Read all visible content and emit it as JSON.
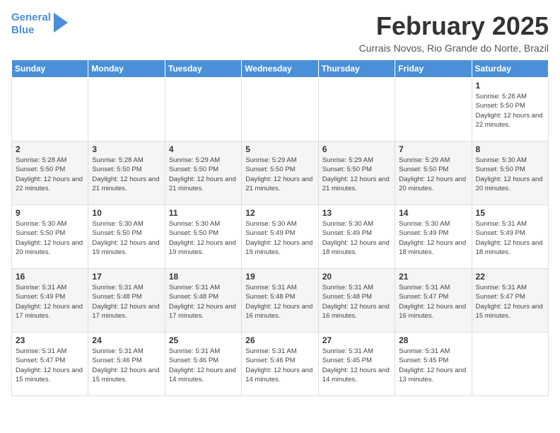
{
  "logo": {
    "line1": "General",
    "line2": "Blue"
  },
  "title": "February 2025",
  "location": "Currais Novos, Rio Grande do Norte, Brazil",
  "days_of_week": [
    "Sunday",
    "Monday",
    "Tuesday",
    "Wednesday",
    "Thursday",
    "Friday",
    "Saturday"
  ],
  "weeks": [
    [
      {
        "day": "",
        "info": ""
      },
      {
        "day": "",
        "info": ""
      },
      {
        "day": "",
        "info": ""
      },
      {
        "day": "",
        "info": ""
      },
      {
        "day": "",
        "info": ""
      },
      {
        "day": "",
        "info": ""
      },
      {
        "day": "1",
        "info": "Sunrise: 5:28 AM\nSunset: 5:50 PM\nDaylight: 12 hours and 22 minutes."
      }
    ],
    [
      {
        "day": "2",
        "info": "Sunrise: 5:28 AM\nSunset: 5:50 PM\nDaylight: 12 hours and 22 minutes."
      },
      {
        "day": "3",
        "info": "Sunrise: 5:28 AM\nSunset: 5:50 PM\nDaylight: 12 hours and 21 minutes."
      },
      {
        "day": "4",
        "info": "Sunrise: 5:29 AM\nSunset: 5:50 PM\nDaylight: 12 hours and 21 minutes."
      },
      {
        "day": "5",
        "info": "Sunrise: 5:29 AM\nSunset: 5:50 PM\nDaylight: 12 hours and 21 minutes."
      },
      {
        "day": "6",
        "info": "Sunrise: 5:29 AM\nSunset: 5:50 PM\nDaylight: 12 hours and 21 minutes."
      },
      {
        "day": "7",
        "info": "Sunrise: 5:29 AM\nSunset: 5:50 PM\nDaylight: 12 hours and 20 minutes."
      },
      {
        "day": "8",
        "info": "Sunrise: 5:30 AM\nSunset: 5:50 PM\nDaylight: 12 hours and 20 minutes."
      }
    ],
    [
      {
        "day": "9",
        "info": "Sunrise: 5:30 AM\nSunset: 5:50 PM\nDaylight: 12 hours and 20 minutes."
      },
      {
        "day": "10",
        "info": "Sunrise: 5:30 AM\nSunset: 5:50 PM\nDaylight: 12 hours and 19 minutes."
      },
      {
        "day": "11",
        "info": "Sunrise: 5:30 AM\nSunset: 5:50 PM\nDaylight: 12 hours and 19 minutes."
      },
      {
        "day": "12",
        "info": "Sunrise: 5:30 AM\nSunset: 5:49 PM\nDaylight: 12 hours and 19 minutes."
      },
      {
        "day": "13",
        "info": "Sunrise: 5:30 AM\nSunset: 5:49 PM\nDaylight: 12 hours and 18 minutes."
      },
      {
        "day": "14",
        "info": "Sunrise: 5:30 AM\nSunset: 5:49 PM\nDaylight: 12 hours and 18 minutes."
      },
      {
        "day": "15",
        "info": "Sunrise: 5:31 AM\nSunset: 5:49 PM\nDaylight: 12 hours and 18 minutes."
      }
    ],
    [
      {
        "day": "16",
        "info": "Sunrise: 5:31 AM\nSunset: 5:49 PM\nDaylight: 12 hours and 17 minutes."
      },
      {
        "day": "17",
        "info": "Sunrise: 5:31 AM\nSunset: 5:48 PM\nDaylight: 12 hours and 17 minutes."
      },
      {
        "day": "18",
        "info": "Sunrise: 5:31 AM\nSunset: 5:48 PM\nDaylight: 12 hours and 17 minutes."
      },
      {
        "day": "19",
        "info": "Sunrise: 5:31 AM\nSunset: 5:48 PM\nDaylight: 12 hours and 16 minutes."
      },
      {
        "day": "20",
        "info": "Sunrise: 5:31 AM\nSunset: 5:48 PM\nDaylight: 12 hours and 16 minutes."
      },
      {
        "day": "21",
        "info": "Sunrise: 5:31 AM\nSunset: 5:47 PM\nDaylight: 12 hours and 16 minutes."
      },
      {
        "day": "22",
        "info": "Sunrise: 5:31 AM\nSunset: 5:47 PM\nDaylight: 12 hours and 15 minutes."
      }
    ],
    [
      {
        "day": "23",
        "info": "Sunrise: 5:31 AM\nSunset: 5:47 PM\nDaylight: 12 hours and 15 minutes."
      },
      {
        "day": "24",
        "info": "Sunrise: 5:31 AM\nSunset: 5:46 PM\nDaylight: 12 hours and 15 minutes."
      },
      {
        "day": "25",
        "info": "Sunrise: 5:31 AM\nSunset: 5:46 PM\nDaylight: 12 hours and 14 minutes."
      },
      {
        "day": "26",
        "info": "Sunrise: 5:31 AM\nSunset: 5:46 PM\nDaylight: 12 hours and 14 minutes."
      },
      {
        "day": "27",
        "info": "Sunrise: 5:31 AM\nSunset: 5:45 PM\nDaylight: 12 hours and 14 minutes."
      },
      {
        "day": "28",
        "info": "Sunrise: 5:31 AM\nSunset: 5:45 PM\nDaylight: 12 hours and 13 minutes."
      },
      {
        "day": "",
        "info": ""
      }
    ]
  ]
}
